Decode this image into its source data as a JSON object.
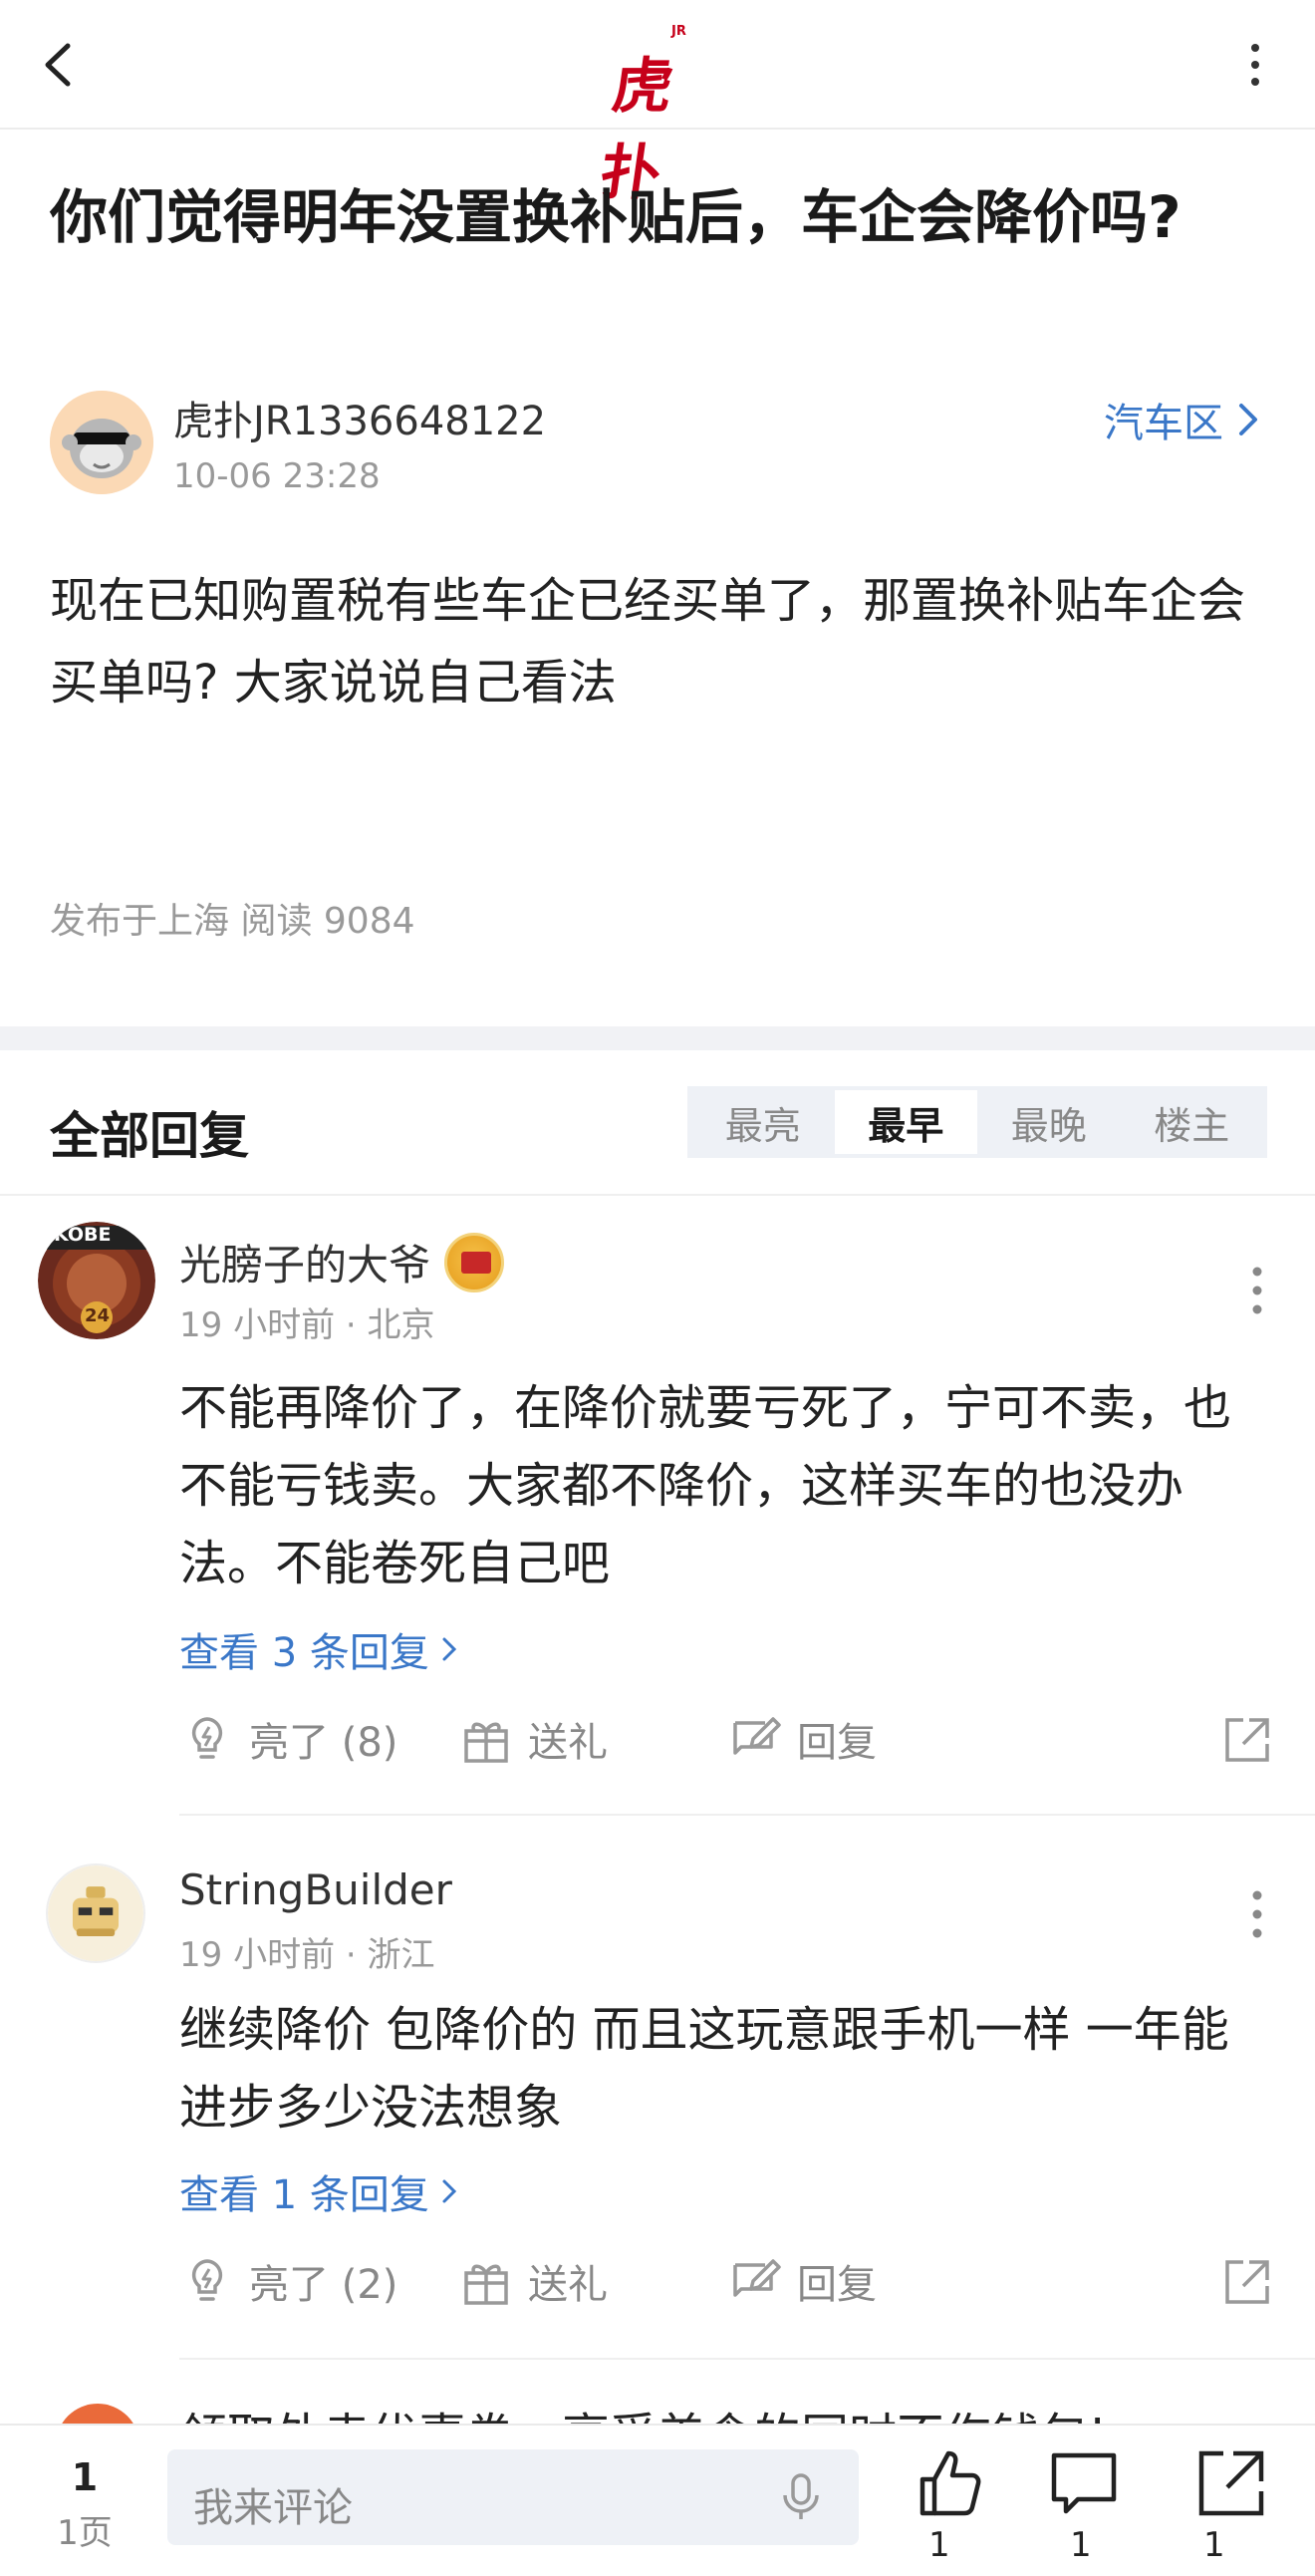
{
  "header": {
    "logo_text": "虎扑",
    "logo_sup": "JR"
  },
  "post": {
    "title": "你们觉得明年没置换补贴后，车企会降价吗?",
    "author": "虎扑JR1336648122",
    "time": "10-06 23:28",
    "board": "汽车区",
    "body": "现在已知购置税有些车企已经买单了，那置换补贴车企会买单吗? 大家说说自己看法",
    "meta": "发布于上海  阅读 9084"
  },
  "replies": {
    "title": "全部回复",
    "tabs": [
      "最亮",
      "最早",
      "最晚",
      "楼主"
    ],
    "active_tab": "最早",
    "items": [
      {
        "name": "光膀子的大爷",
        "time": "19 小时前 · 北京",
        "text": "不能再降价了，在降价就要亏死了，宁可不卖，也不能亏钱卖。大家都不降价，这样买车的也没办法。不能卷死自己吧",
        "view_replies": "查看 3 条回复",
        "like": "亮了 (8)",
        "gift": "送礼",
        "reply": "回复",
        "avatar_text": "KOBE",
        "avatar_num": "24"
      },
      {
        "name": "StringBuilder",
        "time": "19 小时前 · 浙江",
        "text": "继续降价 包降价的 而且这玩意跟手机一样 一年能进步多少没法想象",
        "view_replies": "查看 1 条回复",
        "like": "亮了 (2)",
        "gift": "送礼",
        "reply": "回复"
      }
    ],
    "peek_text": "领取外卖优惠券，享受美食的同时不伤钱包!"
  },
  "bottom_bar": {
    "page_num": "1",
    "page_total": "1页",
    "input_placeholder": "我来评论",
    "like_count": "1",
    "comment_count": "1",
    "share_count": "1"
  },
  "colors": {
    "brand": "#c6001a",
    "link": "#3a77c8"
  }
}
